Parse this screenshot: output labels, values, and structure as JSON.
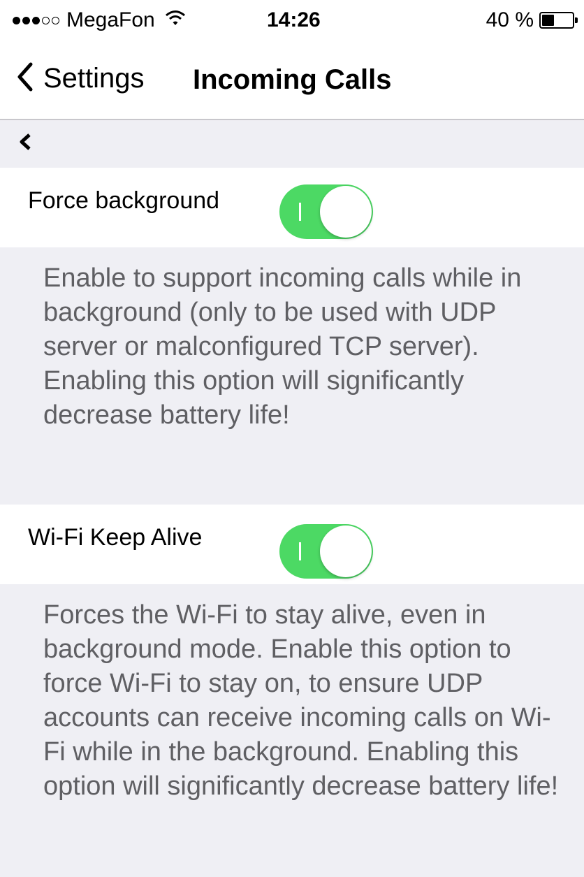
{
  "status_bar": {
    "signal_full": 3,
    "signal_total": 5,
    "carrier": "MegaFon",
    "time": "14:26",
    "battery_percent_label": "40 %",
    "battery_level": 0.4
  },
  "nav": {
    "back_label": "Settings",
    "title": "Incoming Calls"
  },
  "settings": [
    {
      "label": "Force background",
      "enabled": true,
      "description": "Enable to support incoming calls while in background (only to be used with UDP server or malconfigured TCP server). Enabling this option will significantly decrease battery life!"
    },
    {
      "label": "Wi-Fi Keep Alive",
      "enabled": true,
      "description": "Forces the Wi-Fi to stay alive, even in background mode. Enable this option to force Wi-Fi to stay on, to ensure UDP accounts can receive incoming calls on Wi-Fi while in the background. Enabling this option will significantly decrease battery life!"
    }
  ],
  "colors": {
    "toggle_on": "#4cd964",
    "group_background": "#efeff4",
    "description_text": "#5f5f63"
  },
  "icons": {
    "back": "chevron-left-icon",
    "wifi": "wifi-icon",
    "battery": "battery-icon"
  }
}
